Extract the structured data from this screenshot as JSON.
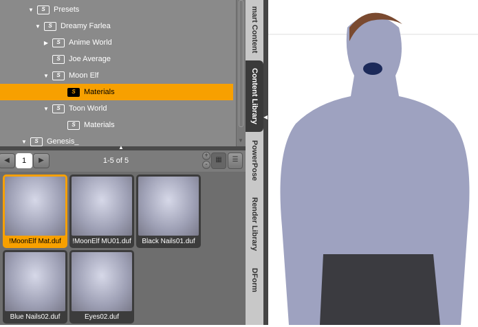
{
  "tree": [
    {
      "label": "Presets",
      "expanded": true
    },
    {
      "label": "Dreamy Farlea",
      "expanded": true
    },
    {
      "label": "Anime World",
      "expanded": false
    },
    {
      "label": "Joe Average"
    },
    {
      "label": "Moon Elf",
      "expanded": true
    },
    {
      "label": "Materials",
      "selected": true
    },
    {
      "label": "Toon World",
      "expanded": true
    },
    {
      "label": "Materials"
    },
    {
      "label": "Genesis_",
      "expanded": true
    }
  ],
  "folder_glyph": "S",
  "toolbar": {
    "page": "1",
    "count": "1-5 of 5",
    "zoom_in": "+",
    "zoom_out": "-"
  },
  "items": [
    {
      "label": "!MoonElf Mat.duf",
      "selected": true
    },
    {
      "label": "!MoonElf MU01.duf"
    },
    {
      "label": "Black Nails01.duf"
    },
    {
      "label": "Blue Nails02.duf"
    },
    {
      "label": "Eyes02.duf"
    }
  ],
  "tabs": [
    {
      "label": "mart Content"
    },
    {
      "label": "Content Library",
      "active": true
    },
    {
      "label": "PowerPose"
    },
    {
      "label": "Render Library"
    },
    {
      "label": "DForm"
    }
  ],
  "colors": {
    "accent": "#f7a000"
  }
}
